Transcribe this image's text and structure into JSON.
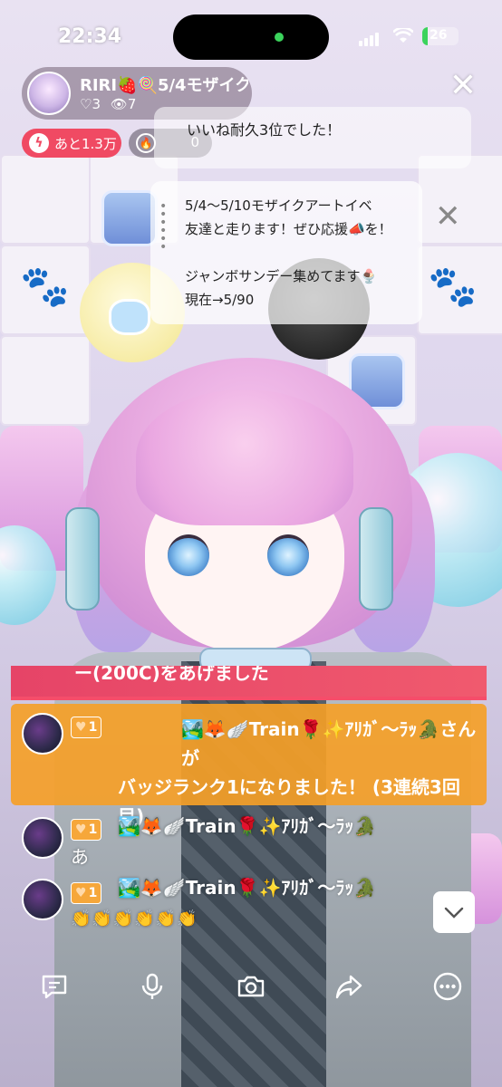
{
  "status_bar": {
    "time": "22:34",
    "battery": "26"
  },
  "header": {
    "host_name": "RIRI🍓🍭5/4モザイクアート",
    "likes": "♡3",
    "viewers": "👁7",
    "points_pill": "あと1.3万",
    "flame_count": "0",
    "icons": [
      "lightning-icon",
      "flame-icon",
      "close-icon"
    ]
  },
  "notices": {
    "pinned": "いいね耐久3位でした！",
    "announcement": "5/4〜5/10モザイクアートイベ\n友達と走ります！ぜひ応援📣を！\n\nジャンボサンデー集めてます🍨\n現在→5/90"
  },
  "chat": {
    "banner_text": "ー(200C)をあげました",
    "rank_message": {
      "badge": "1",
      "name": "🏞️🦊🪽Train🌹✨ｱﾘｶﾞ～ﾗｯ🐊さんが",
      "text": "バッジランク1になりました！ (3連続3回目)"
    },
    "messages": [
      {
        "badge": "1",
        "name": "🏞️🦊🪽Train🌹✨ｱﾘｶﾞ～ﾗｯ🐊",
        "body": "あ"
      },
      {
        "badge": "1",
        "name": "🏞️🦊🪽Train🌹✨ｱﾘｶﾞ～ﾗｯ🐊",
        "body": "👏👏👏👏👏👏"
      }
    ],
    "scroll_icon": "chevron-down-icon"
  },
  "toolbar": {
    "icons": [
      "comment-icon",
      "microphone-icon",
      "camera-icon",
      "share-icon",
      "more-icon"
    ]
  },
  "colors": {
    "accent_red": "#f04a63",
    "rank_orange": "#f5a028",
    "badge_orange": "#f6a73a",
    "online_green": "#3bd35c"
  }
}
